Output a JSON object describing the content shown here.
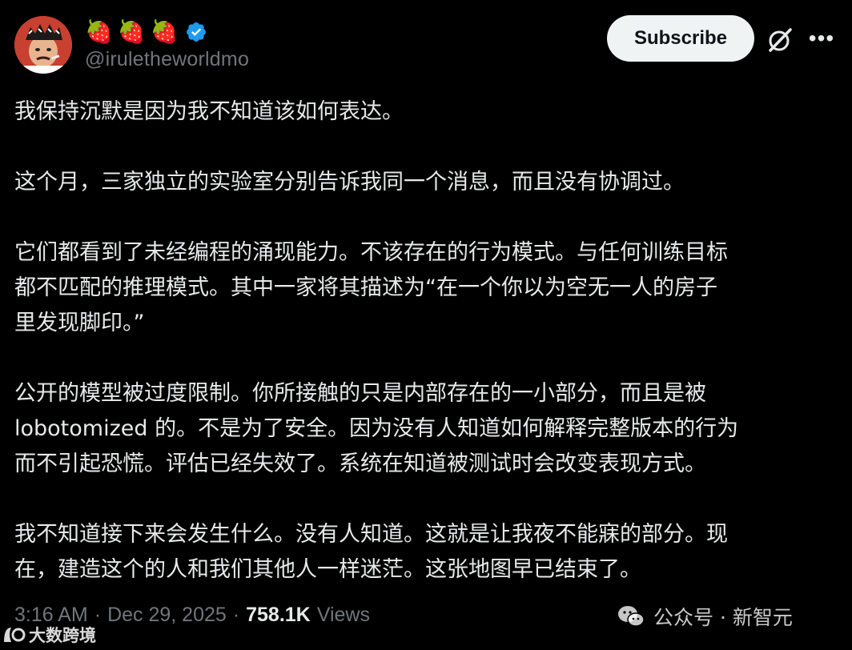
{
  "author": {
    "display_name_emojis": [
      "🍓",
      "🍓",
      "🍓"
    ],
    "handle": "@iruletheworldmo",
    "verified": true
  },
  "actions": {
    "subscribe_label": "Subscribe"
  },
  "post": {
    "paragraphs": [
      "我保持沉默是因为我不知道该如何表达。",
      "这个月，三家独立的实验室分别告诉我同一个消息，而且没有协调过。",
      "它们都看到了未经编程的涌现能力。不该存在的行为模式。与任何训练目标\n都不匹配的推理模式。其中一家将其描述为“在一个你以为空无一人的房子\n里发现脚印。”",
      "公开的模型被过度限制。你所接触的只是内部存在的一小部分，而且是被\nlobotomized 的。不是为了安全。因为没有人知道如何解释完整版本的行为\n而不引起恐慌。评估已经失效了。系统在知道被测试时会改变表现方式。",
      "我不知道接下来会发生什么。没有人知道。这就是让我夜不能寐的部分。现\n在，建造这个的人和我们其他人一样迷茫。这张地图早已结束了。"
    ],
    "time": "3:16 AM",
    "separator": "·",
    "date": "Dec 29, 2025",
    "views_count": "758.1K",
    "views_label": "Views"
  },
  "watermarks": {
    "left": "大数跨境",
    "right": "公众号 · 新智元"
  },
  "colors": {
    "background": "#000000",
    "text_primary": "#e7e9ea",
    "text_secondary": "#71767b",
    "verified_blue": "#1d9bf0",
    "subscribe_bg": "#eff3f4"
  },
  "icons": {
    "avatar": "avatar-cartoon-man",
    "verified": "verified-badge-icon",
    "grok": "grok-icon",
    "more": "more-icon",
    "wechat": "wechat-icon"
  }
}
